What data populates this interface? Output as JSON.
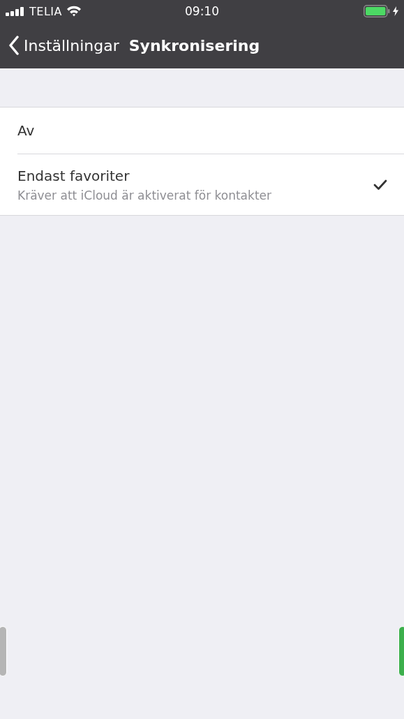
{
  "status_bar": {
    "carrier": "TELIA",
    "time": "09:10",
    "charging": true
  },
  "nav_bar": {
    "back_label": "Inställningar",
    "title": "Synkronisering"
  },
  "options": [
    {
      "label": "Av",
      "selected": false
    },
    {
      "label": "Endast favoriter",
      "subtitle": "Kräver att iCloud är aktiverat för kontakter",
      "selected": true
    }
  ]
}
